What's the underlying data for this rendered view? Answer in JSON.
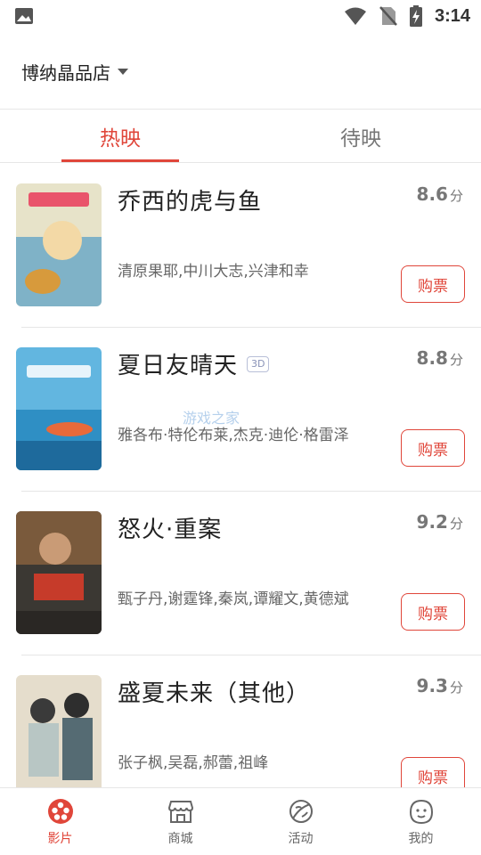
{
  "status_bar": {
    "time": "3:14"
  },
  "store": {
    "name": "博纳晶品店"
  },
  "tabs": [
    {
      "label": "热映",
      "active": true
    },
    {
      "label": "待映",
      "active": false
    }
  ],
  "movies": [
    {
      "title": "乔西的虎与鱼",
      "badge": "",
      "score": "8.6",
      "score_unit": "分",
      "cast": "清原果耶,中川大志,兴津和幸",
      "buy_label": "购票",
      "poster_colors": [
        "#e7e3c9",
        "#7fb2c7",
        "#d79a3c"
      ]
    },
    {
      "title": "夏日友晴天",
      "badge": "3D",
      "score": "8.8",
      "score_unit": "分",
      "cast": "雅各布·特伦布莱,杰克·迪伦·格雷泽",
      "buy_label": "购票",
      "poster_colors": [
        "#62b6e0",
        "#2f8fc4",
        "#1e6a9c"
      ]
    },
    {
      "title": "怒火·重案",
      "badge": "",
      "score": "9.2",
      "score_unit": "分",
      "cast": "甄子丹,谢霆锋,秦岚,谭耀文,黄德斌",
      "buy_label": "购票",
      "poster_colors": [
        "#7a5a3c",
        "#c63b2a",
        "#3b3833"
      ]
    },
    {
      "title": "盛夏未来（其他）",
      "badge": "",
      "score": "9.3",
      "score_unit": "分",
      "cast": "张子枫,吴磊,郝蕾,祖峰",
      "buy_label": "购票",
      "poster_colors": [
        "#e5ddcc",
        "#b8c6c4",
        "#556b73"
      ]
    }
  ],
  "bottom_nav": [
    {
      "label": "影片",
      "icon": "film-reel-icon",
      "active": true
    },
    {
      "label": "商城",
      "icon": "store-icon",
      "active": false
    },
    {
      "label": "活动",
      "icon": "planet-icon",
      "active": false
    },
    {
      "label": "我的",
      "icon": "smiley-face-icon",
      "active": false
    }
  ],
  "watermark": "游戏之家",
  "colors": {
    "accent": "#e0463a",
    "text": "#222222",
    "muted": "#777777",
    "divider": "#e6e6e6"
  }
}
